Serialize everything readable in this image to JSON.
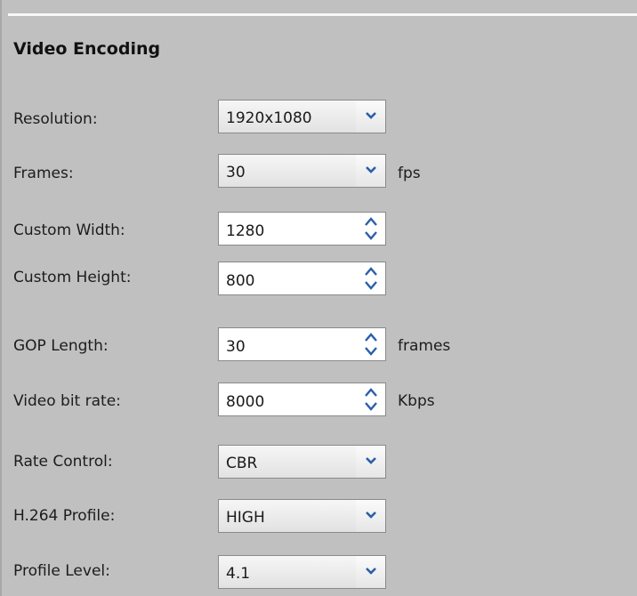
{
  "section": {
    "title": "Video Encoding"
  },
  "fields": {
    "resolution": {
      "label": "Resolution:",
      "value": "1920x1080"
    },
    "frames": {
      "label": "Frames:",
      "value": "30",
      "unit": "fps"
    },
    "custom_width": {
      "label": "Custom Width:",
      "value": "1280"
    },
    "custom_height": {
      "label": "Custom Height:",
      "value": "800"
    },
    "gop_length": {
      "label": "GOP Length:",
      "value": "30",
      "unit": "frames"
    },
    "video_bit_rate": {
      "label": "Video bit rate:",
      "value": "8000",
      "unit": "Kbps"
    },
    "rate_control": {
      "label": "Rate Control:",
      "value": "CBR"
    },
    "h264_profile": {
      "label": "H.264 Profile:",
      "value": "HIGH"
    },
    "profile_level": {
      "label": "Profile Level:",
      "value": "4.1"
    }
  },
  "icons": {
    "dropdown": "chevron-down-icon",
    "spin_up": "spin-up-icon",
    "spin_down": "spin-down-icon"
  },
  "colors": {
    "background": "#c0c0c0",
    "arrow": "#2a5fa8"
  }
}
